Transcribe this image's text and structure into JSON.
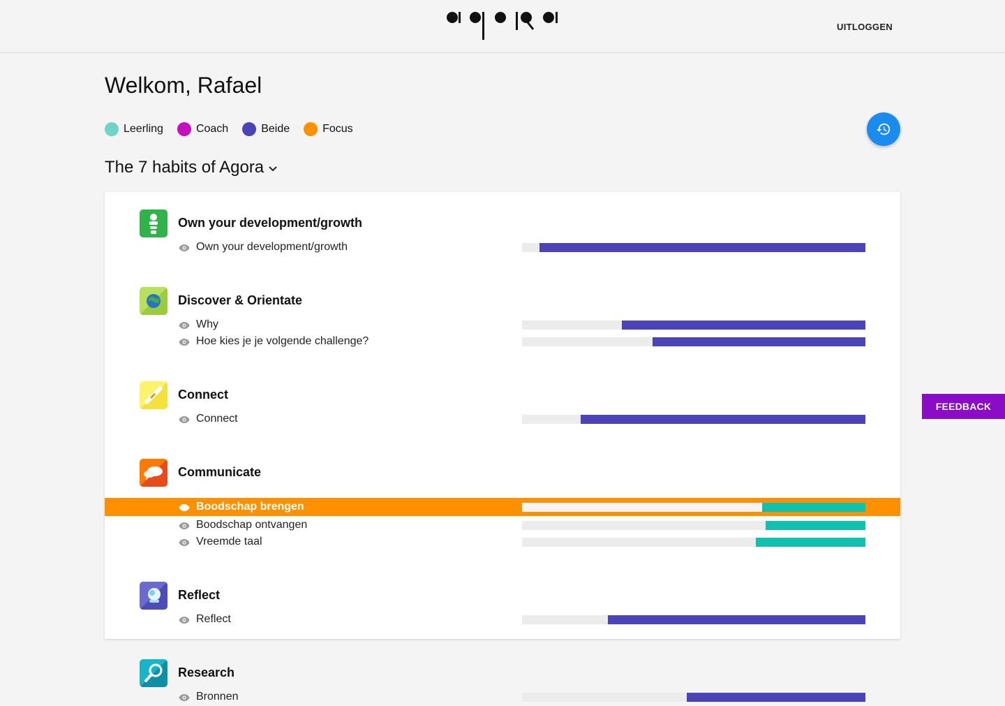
{
  "header": {
    "logout_label": "UITLOGGEN"
  },
  "welcome": "Welkom, Rafael",
  "legend": [
    {
      "label": "Leerling",
      "color": "#6fd3c8"
    },
    {
      "label": "Coach",
      "color": "#c40fbf"
    },
    {
      "label": "Beide",
      "color": "#4b43b8"
    },
    {
      "label": "Focus",
      "color": "#ff9100"
    }
  ],
  "history_button": {
    "icon": "history-icon",
    "color": "#1a8cf0"
  },
  "framework": {
    "title": "The 7 habits of Agora",
    "icon": "chevron-down-icon"
  },
  "colors": {
    "beide": "#4b43b8",
    "leerling": "#10c2ae",
    "focus": "#ff9100",
    "feedback": "#8a0cc6"
  },
  "habits": [
    {
      "title": "Own your development/growth",
      "icon": "growth-icon",
      "goals": [
        {
          "label": "Own your development/growth",
          "progress": 0.95,
          "series": "beide",
          "focus": false
        }
      ]
    },
    {
      "title": "Discover & Orientate",
      "icon": "globe-icon",
      "goals": [
        {
          "label": "Why",
          "progress": 0.71,
          "series": "beide",
          "focus": false
        },
        {
          "label": "Hoe kies je je volgende challenge?",
          "progress": 0.62,
          "series": "beide",
          "focus": false
        }
      ]
    },
    {
      "title": "Connect",
      "icon": "connect-icon",
      "goals": [
        {
          "label": "Connect",
          "progress": 0.83,
          "series": "beide",
          "focus": false
        }
      ]
    },
    {
      "title": "Communicate",
      "icon": "speech-bubble-icon",
      "goals": [
        {
          "label": "Boodschap brengen",
          "progress": 0.3,
          "series": "leerling",
          "focus": true
        },
        {
          "label": "Boodschap ontvangen",
          "progress": 0.29,
          "series": "leerling",
          "focus": false
        },
        {
          "label": "Vreemde taal",
          "progress": 0.32,
          "series": "leerling",
          "focus": false
        }
      ]
    },
    {
      "title": "Reflect",
      "icon": "reflect-icon",
      "goals": [
        {
          "label": "Reflect",
          "progress": 0.75,
          "series": "beide",
          "focus": false
        }
      ]
    },
    {
      "title": "Research",
      "icon": "magnifier-icon",
      "goals": [
        {
          "label": "Bronnen",
          "progress": 0.52,
          "series": "beide",
          "focus": false
        }
      ]
    }
  ],
  "feedback_label": "FEEDBACK"
}
